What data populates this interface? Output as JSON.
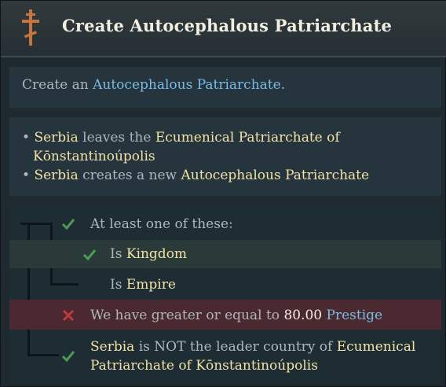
{
  "window": {
    "title": "Create Autocephalous Patriarchate",
    "icon": "orthodox-cross-icon"
  },
  "description": {
    "prefix": "Create an ",
    "link": "Autocephalous Patriarchate",
    "suffix": "."
  },
  "effects": [
    {
      "bullet": "•",
      "subject": "Serbia",
      "verb": " leaves the ",
      "object_line1": "Ecumenical Patriarchate of",
      "object_line2": "Kōnstantinoúpolis"
    },
    {
      "bullet": "•",
      "subject": "Serbia",
      "verb": " creates a new ",
      "object": "Autocephalous Patriarchate"
    }
  ],
  "requirements": [
    {
      "status": "check",
      "text": "At least one of these:"
    },
    {
      "status": "check",
      "prefix": "Is ",
      "value": "Kingdom"
    },
    {
      "status": "none",
      "prefix": "Is ",
      "value": "Empire"
    },
    {
      "status": "cross",
      "prefix": "We have greater or equal to ",
      "number": "80.00",
      "link": "Prestige"
    },
    {
      "status": "check",
      "subject": "Serbia",
      "middle": " is NOT the leader country of ",
      "object_line1": "Ecumenical",
      "object_line2": "Patriarchate of Kōnstantinoúpolis"
    }
  ],
  "colors": {
    "highlight": "#f1e3a6",
    "link": "#79bde6",
    "body_text": "#aeb8bc",
    "check": "#4f9a55",
    "cross": "#c0393b",
    "failed_row": "#4a2a30",
    "met_row": "#2a3a39"
  }
}
